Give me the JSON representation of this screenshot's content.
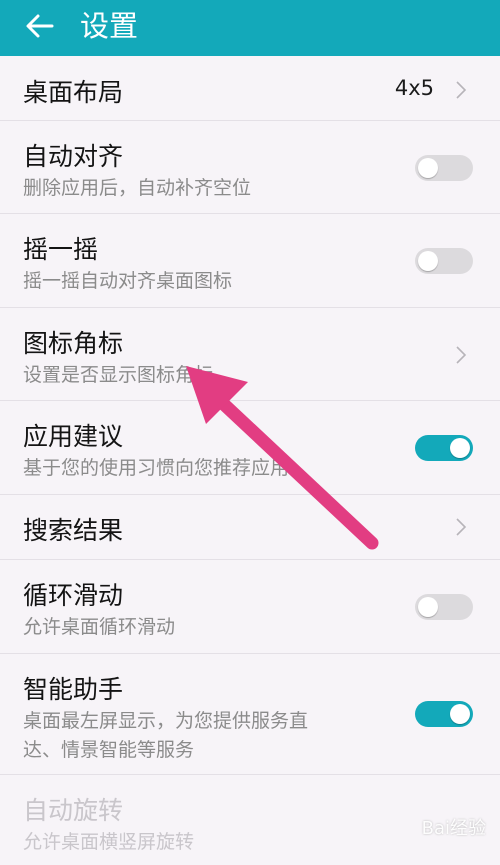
{
  "header": {
    "title": "设置"
  },
  "rows": [
    {
      "title": "桌面布局",
      "value": "4x5"
    },
    {
      "title": "自动对齐",
      "subtitle": "删除应用后，自动补齐空位",
      "toggle": false
    },
    {
      "title": "摇一摇",
      "subtitle": "摇一摇自动对齐桌面图标",
      "toggle": false
    },
    {
      "title": "图标角标",
      "subtitle": "设置是否显示图标角标"
    },
    {
      "title": "应用建议",
      "subtitle": "基于您的使用习惯向您推荐应用",
      "toggle": true
    },
    {
      "title": "搜索结果"
    },
    {
      "title": "循环滑动",
      "subtitle": "允许桌面循环滑动",
      "toggle": false
    },
    {
      "title": "智能助手",
      "subtitle_line1": "桌面最左屏显示，为您提供服务直",
      "subtitle_line2": "达、情景智能等服务",
      "toggle": true
    },
    {
      "title": "自动旋转",
      "subtitle": "允许桌面横竖屏旋转",
      "disabled": true
    }
  ],
  "watermark": "Bai经验",
  "colors": {
    "accent": "#13a9ba",
    "annotation_arrow": "#e23d82"
  },
  "icons": {
    "back": "arrow-left-icon",
    "chevron": "chevron-right-icon"
  }
}
